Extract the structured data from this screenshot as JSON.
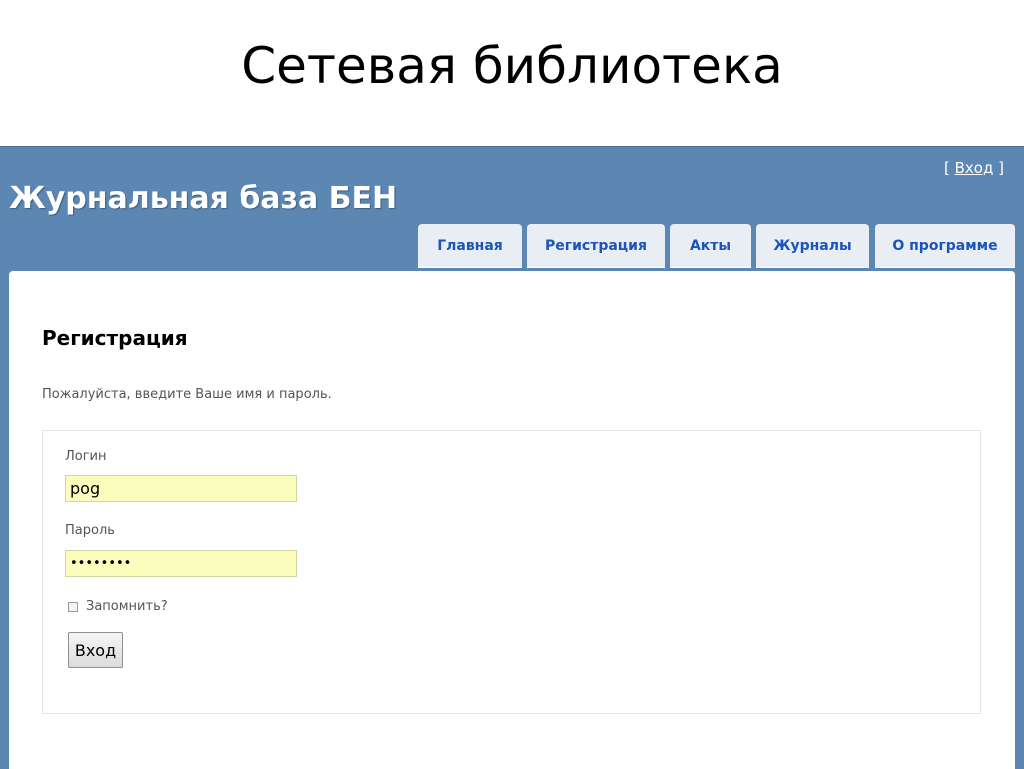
{
  "slide": {
    "title": "Сетевая библиотека"
  },
  "header": {
    "site_title": "Журнальная база БЕН",
    "login": {
      "open_bracket": "[",
      "link_label": "Вход",
      "close_bracket": "]"
    }
  },
  "menu": {
    "tabs": [
      {
        "label": "Главная"
      },
      {
        "label": "Регистрация"
      },
      {
        "label": "Акты"
      },
      {
        "label": "Журналы"
      },
      {
        "label": "О программе"
      }
    ]
  },
  "main": {
    "heading": "Регистрация",
    "intro": "Пожалуйста, введите Ваше имя и пароль.",
    "form": {
      "login_label": "Логин",
      "login_value": "pog",
      "password_label": "Пароль",
      "password_value": "••••••••",
      "remember_label": "Запомнить?",
      "remember_checked": false,
      "submit_label": "Вход"
    }
  },
  "colors": {
    "header_background": "#5c87b2",
    "tab_background": "#e8eef4",
    "tab_text": "#1c54b8",
    "input_background": "#fbfdbd"
  }
}
